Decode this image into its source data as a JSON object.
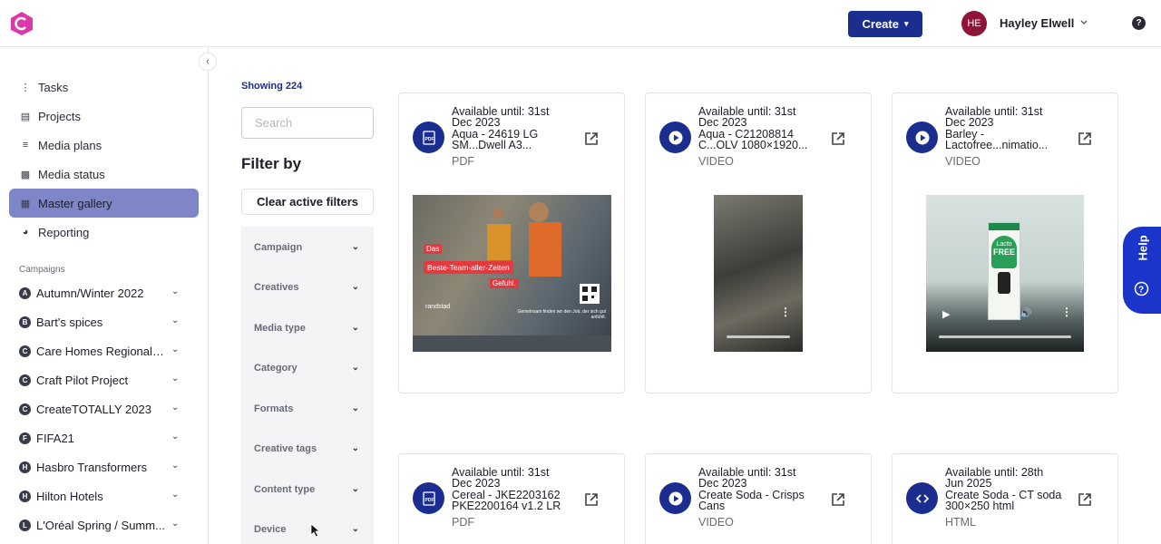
{
  "header": {
    "create_label": "Create",
    "user_initials": "HE",
    "user_name": "Hayley Elwell"
  },
  "sidebar": {
    "nav": [
      {
        "label": "Tasks",
        "icon": "tasks-icon"
      },
      {
        "label": "Projects",
        "icon": "projects-icon"
      },
      {
        "label": "Media plans",
        "icon": "media-plans-icon"
      },
      {
        "label": "Media status",
        "icon": "media-status-icon"
      },
      {
        "label": "Master gallery",
        "icon": "gallery-icon",
        "active": true
      },
      {
        "label": "Reporting",
        "icon": "reporting-icon"
      }
    ],
    "campaigns_label": "Campaigns",
    "campaigns": [
      {
        "letter": "A",
        "label": "Autumn/Winter 2022"
      },
      {
        "letter": "B",
        "label": "Bart's spices"
      },
      {
        "letter": "C",
        "label": "Care Homes Regional ..."
      },
      {
        "letter": "C",
        "label": "Craft Pilot Project"
      },
      {
        "letter": "C",
        "label": "CreateTOTALLY 2023"
      },
      {
        "letter": "F",
        "label": "FIFA21"
      },
      {
        "letter": "H",
        "label": "Hasbro Transformers"
      },
      {
        "letter": "H",
        "label": "Hilton Hotels"
      },
      {
        "letter": "L",
        "label": "L'Oréal Spring / Summ..."
      }
    ]
  },
  "filters": {
    "showing": "Showing 224",
    "search_placeholder": "Search",
    "title": "Filter by",
    "clear_label": "Clear active filters",
    "items": [
      "Campaign",
      "Creatives",
      "Media type",
      "Category",
      "Formats",
      "Creative tags",
      "Content type",
      "Device"
    ]
  },
  "cards": [
    {
      "avail": "Available until: 31st Dec 2023",
      "title": "Aqua - 24619 LG SM...Dwell A3...",
      "type": "PDF",
      "icon": "pdf-icon"
    },
    {
      "avail": "Available until: 31st Dec 2023",
      "title": "Aqua - C21208814 C...OLV 1080×1920...",
      "type": "VIDEO",
      "icon": "play-icon"
    },
    {
      "avail": "Available until: 31st Dec 2023",
      "title": "Barley - Lactofree...nimatio...",
      "type": "VIDEO",
      "icon": "play-icon"
    },
    {
      "avail": "Available until: 31st Dec 2023",
      "title": "Cereal - JKE2203162 PKE2200164 v1.2 LR",
      "type": "PDF",
      "icon": "pdf-icon"
    },
    {
      "avail": "Available until: 31st Dec 2023",
      "title": "Create Soda - Crisps Cans",
      "type": "VIDEO",
      "icon": "play-icon"
    },
    {
      "avail": "Available until: 28th Jun 2025",
      "title": "Create Soda - CT soda 300×250 html",
      "type": "HTML",
      "icon": "code-icon"
    }
  ],
  "thumb1": {
    "tag_das": "Das",
    "tag_team": "Beste-Team-aller-Zeiten",
    "tag_gefuhl": "Gefuhl.",
    "brand": "randstad",
    "tagline": "Gemeinsam finden wir den Job, der sich gut anfühlt."
  },
  "thumb3": {
    "product_top": "Lacto",
    "product_bottom": "FREE"
  },
  "help_label": "Help",
  "colors": {
    "accent": "#1b2e8f",
    "active_nav": "#7e86c7",
    "help_tab": "#1b34c9"
  }
}
